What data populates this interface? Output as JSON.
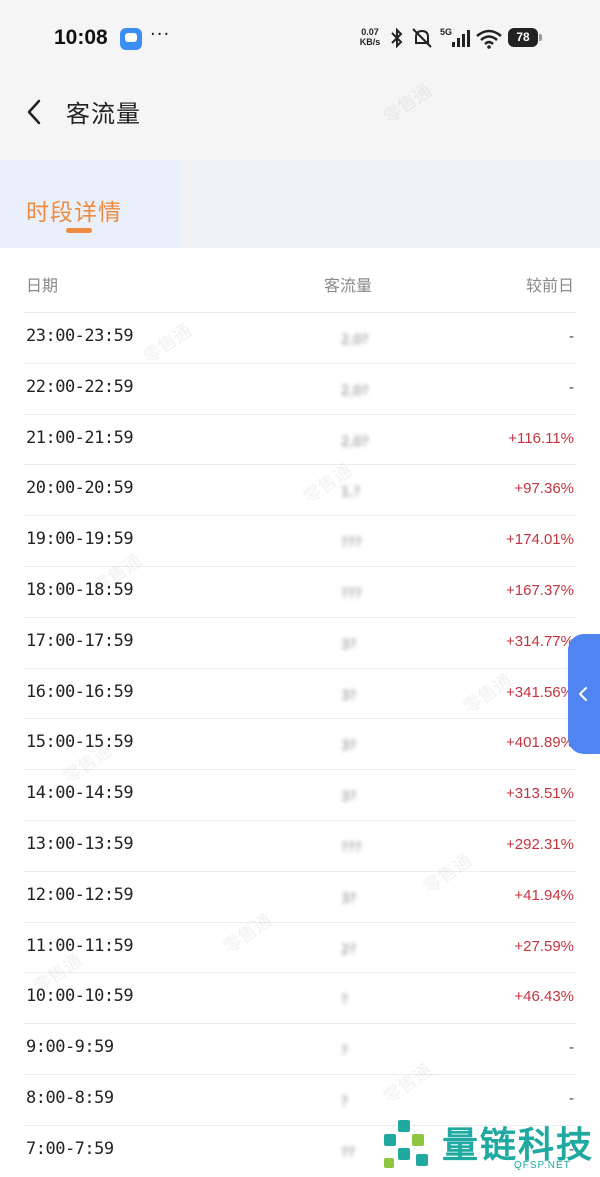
{
  "status_bar": {
    "time": "10:08",
    "more": "···",
    "net_speed_value": "0.07",
    "net_speed_unit": "KB/s",
    "signal_label": "5G",
    "battery": "78"
  },
  "nav": {
    "title": "客流量",
    "back_icon": "chevron-left-icon"
  },
  "tabs": [
    {
      "label": "时段详情",
      "active": true
    }
  ],
  "table": {
    "columns": [
      "日期",
      "客流量",
      "较前日"
    ],
    "rows": [
      {
        "date": "23:00-23:59",
        "count": "2,0?",
        "change": "-"
      },
      {
        "date": "22:00-22:59",
        "count": "2,0?",
        "change": "-"
      },
      {
        "date": "21:00-21:59",
        "count": "2,0?",
        "change": "+116.11%"
      },
      {
        "date": "20:00-20:59",
        "count": "1,?",
        "change": "+97.36%"
      },
      {
        "date": "19:00-19:59",
        "count": "???",
        "change": "+174.01%"
      },
      {
        "date": "18:00-18:59",
        "count": "???",
        "change": "+167.37%"
      },
      {
        "date": "17:00-17:59",
        "count": "3?",
        "change": "+314.77%"
      },
      {
        "date": "16:00-16:59",
        "count": "3?",
        "change": "+341.56%"
      },
      {
        "date": "15:00-15:59",
        "count": "3?",
        "change": "+401.89%"
      },
      {
        "date": "14:00-14:59",
        "count": "3?",
        "change": "+313.51%"
      },
      {
        "date": "13:00-13:59",
        "count": "???",
        "change": "+292.31%"
      },
      {
        "date": "12:00-12:59",
        "count": "3?",
        "change": "+41.94%"
      },
      {
        "date": "11:00-11:59",
        "count": "2?",
        "change": "+27.59%"
      },
      {
        "date": "10:00-10:59",
        "count": "?",
        "change": "+46.43%"
      },
      {
        "date": "9:00-9:59",
        "count": "?",
        "change": "-"
      },
      {
        "date": "8:00-8:59",
        "count": "?",
        "change": "-"
      },
      {
        "date": "7:00-7:59",
        "count": "??",
        "change": "-"
      }
    ]
  },
  "watermark": "零售通",
  "brand": {
    "name": "量链科技",
    "sub": "QFSP.NET"
  },
  "colors": {
    "accent": "#f08a3c",
    "increase": "#c4343e",
    "handle": "#4f84f2",
    "brand": "#1fa9a0"
  }
}
